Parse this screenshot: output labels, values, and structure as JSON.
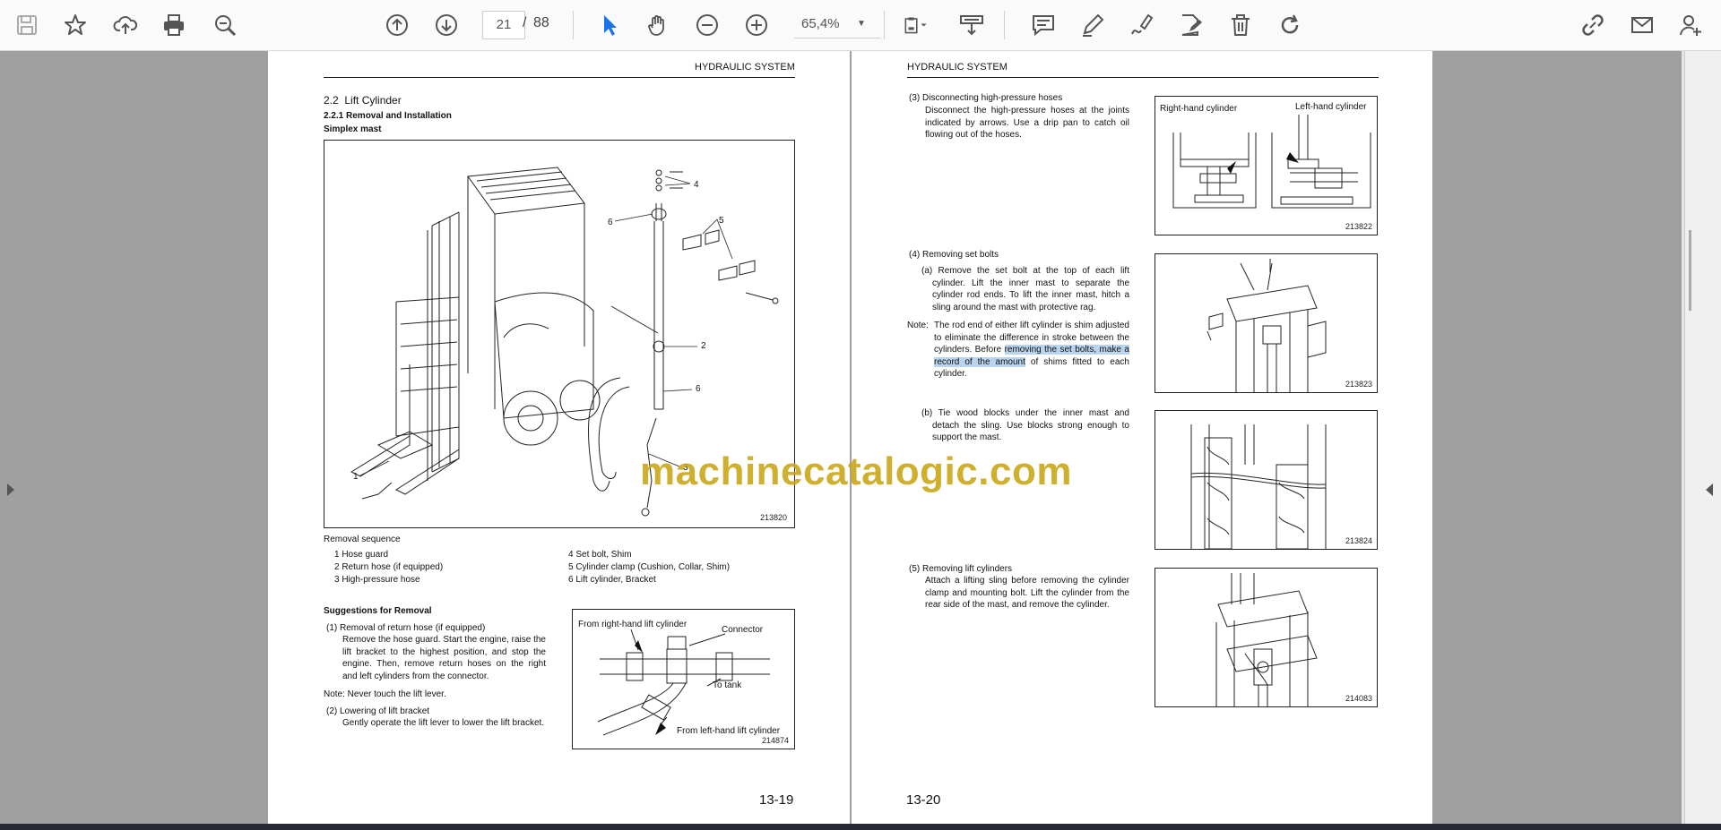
{
  "toolbar": {
    "left_icons": [
      "save-icon",
      "bookmark-star-icon",
      "upload-cloud-icon",
      "print-icon",
      "zoom-search-icon"
    ],
    "nav_icons": [
      "page-up-icon",
      "page-down-icon"
    ],
    "current_page": "21",
    "page_separator": "/",
    "total_pages": "88",
    "tool_icons": [
      "select-cursor-icon",
      "hand-pan-icon",
      "zoom-out-icon",
      "zoom-in-icon"
    ],
    "zoom_level": "65,4%",
    "right_icons": [
      "page-fit-icon",
      "download-scroll-icon",
      "comment-icon",
      "pen-icon",
      "sign-pen-icon",
      "edit-document-icon",
      "trash-icon",
      "redo-icon",
      "link-icon",
      "mail-icon",
      "add-user-icon"
    ],
    "accent_color": "#1a73e8"
  },
  "left_page": {
    "running_header": "HYDRAULIC SYSTEM",
    "section_number": "2.2",
    "section_title": "Lift Cylinder",
    "subsection": "2.2.1   Removal and Installation",
    "mast_label": "Simplex mast",
    "figure_id": "213820",
    "callouts": [
      "4",
      "6",
      "5",
      "2",
      "6",
      "1",
      "3"
    ],
    "removal_sequence_title": "Removal sequence",
    "removal_left": [
      "1  Hose guard",
      "2  Return hose (if equipped)",
      "3  High-pressure hose"
    ],
    "removal_right": [
      "4  Set bolt, Shim",
      "5  Cylinder clamp (Cushion, Collar, Shim)",
      "6  Lift cylinder, Bracket"
    ],
    "suggestions_title": "Suggestions for Removal",
    "step1_title": "(1)  Removal of return hose (if equipped)",
    "step1_body": "Remove the hose guard. Start the engine, raise the lift bracket to the highest position, and stop the engine. Then, remove return hoses on the right and left cylinders from the connector.",
    "note1": "Note:  Never touch the lift lever.",
    "step2_title": "(2)  Lowering of lift bracket",
    "step2_body": "Gently operate the lift lever to lower the lift bracket.",
    "fig2_label_right": "From right-hand lift cylinder",
    "fig2_label_connector": "Connector",
    "fig2_label_tank": "To tank",
    "fig2_label_left": "From left-hand lift cylinder",
    "fig2_id": "214874",
    "page_number": "13-19"
  },
  "right_page": {
    "running_header": "HYDRAULIC SYSTEM",
    "step3_title": "(3)  Disconnecting high-pressure hoses",
    "step3_body": "Disconnect the high-pressure hoses at the joints indicated by arrows. Use a drip pan to catch oil flowing out of the hoses.",
    "fig3_label_right": "Right-hand cylinder",
    "fig3_label_left": "Left-hand cylinder",
    "fig3_id": "213822",
    "step4_title": "(4)  Removing set bolts",
    "step4a": "(a)  Remove the set bolt at the top of each lift cylinder. Lift the inner mast to separate the cylinder rod ends. To lift the inner mast, hitch a sling around the mast with protective rag.",
    "note_label": "Note:",
    "note_before": "The rod end of either lift cylinder is shim adjusted to eliminate the difference in stroke between the cylinders. Before ",
    "note_highlight": "removing the set bolts, make a record of the amount",
    "note_after": " of shims fitted to each cylinder.",
    "fig4_id": "213823",
    "step4b": "(b)  Tie wood blocks under the inner mast and detach the sling. Use blocks strong enough to support the mast.",
    "fig5_id": "213824",
    "step5_title": "(5)  Removing lift cylinders",
    "step5_body": "Attach a lifting sling before removing the cylinder clamp and mounting bolt. Lift the cylinder from the rear side of the mast, and remove the cylinder.",
    "fig6_id": "214083",
    "page_number": "13-20"
  },
  "watermark": "machinecatalogic.com"
}
